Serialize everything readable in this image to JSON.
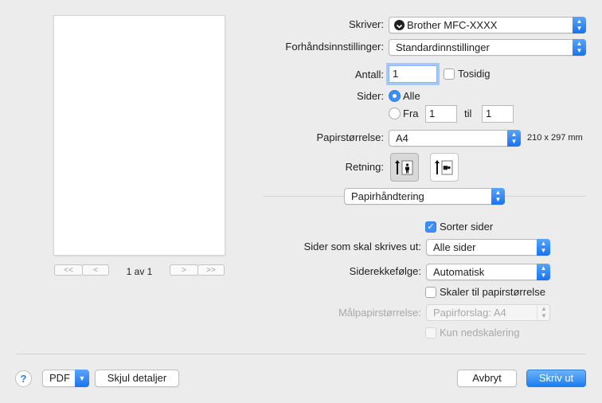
{
  "preview": {
    "first_label": "<<",
    "prev_label": "<",
    "page_count": "1 av 1",
    "next_label": ">",
    "last_label": ">>"
  },
  "printer": {
    "label": "Skriver:",
    "value": "Brother MFC-XXXX"
  },
  "presets": {
    "label": "Forhåndsinnstillinger:",
    "value": "Standardinnstillinger"
  },
  "copies": {
    "label": "Antall:",
    "value": "1",
    "two_sided_label": "Tosidig"
  },
  "pages": {
    "label": "Sider:",
    "all_label": "Alle",
    "from_label": "Fra",
    "from_value": "1",
    "to_label": "til",
    "to_value": "1"
  },
  "paper_size": {
    "label": "Papirstørrelse:",
    "value": "A4",
    "dimensions": "210 x 297 mm"
  },
  "orientation": {
    "label": "Retning:"
  },
  "section": {
    "value": "Papirhåndtering"
  },
  "paper_handling": {
    "collate_label": "Sorter sider",
    "pages_to_print_label": "Sider som skal skrives ut:",
    "pages_to_print_value": "Alle sider",
    "page_order_label": "Siderekkefølge:",
    "page_order_value": "Automatisk",
    "scale_label": "Skaler til papirstørrelse",
    "dest_paper_label": "Målpapirstørrelse:",
    "dest_paper_value": "Papirforslag: A4",
    "scale_down_label": "Kun nedskalering"
  },
  "footer": {
    "help_label": "?",
    "pdf_label": "PDF",
    "hide_details_label": "Skjul detaljer",
    "cancel_label": "Avbryt",
    "print_label": "Skriv ut"
  },
  "colors": {
    "accent": "#3d8ef7",
    "background": "#ececec"
  }
}
